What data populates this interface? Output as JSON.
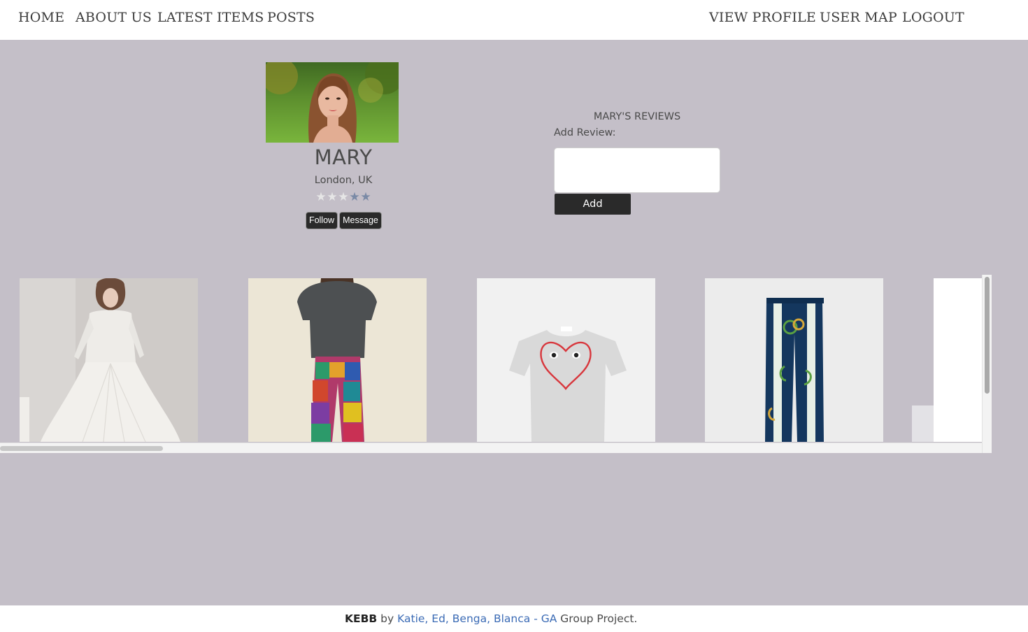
{
  "nav": {
    "home": "HOME",
    "about": "ABOUT US",
    "latest": "LATEST ITEMS",
    "posts": "POSTS",
    "view_profile": "VIEW PROFILE",
    "user_map": "USER MAP",
    "logout": "LOGOUT"
  },
  "profile": {
    "name": "MARY",
    "location": "London, UK",
    "rating": 3,
    "rating_max": 5,
    "follow_label": "Follow",
    "message_label": "Message"
  },
  "reviews": {
    "title": "MARY'S REVIEWS",
    "add_label": "Add Review:",
    "input_value": "",
    "add_button": "Add"
  },
  "items": [
    {
      "icon": "white-lace-wedding-dress-photo"
    },
    {
      "icon": "patchwork-trousers-photo"
    },
    {
      "icon": "heart-tshirt-photo"
    },
    {
      "icon": "striped-snake-print-trousers-photo"
    },
    {
      "icon": "partially-visible-item-photo"
    }
  ],
  "footer": {
    "brand": "KEBB",
    "by": " by ",
    "author1": "Katie",
    "sep1": ", ",
    "author2": "Ed",
    "sep2": ", ",
    "author3": "Benga",
    "sep3": ", ",
    "author4": "Blanca",
    "dash": " - ",
    "ga": "GA",
    "suffix": " Group Project."
  },
  "colors": {
    "background": "#c4bfc8",
    "dark_button": "#2a2a2a",
    "link": "#3b6bb5",
    "star_filled": "#e6e6e6",
    "star_empty": "#7a8aa6"
  }
}
